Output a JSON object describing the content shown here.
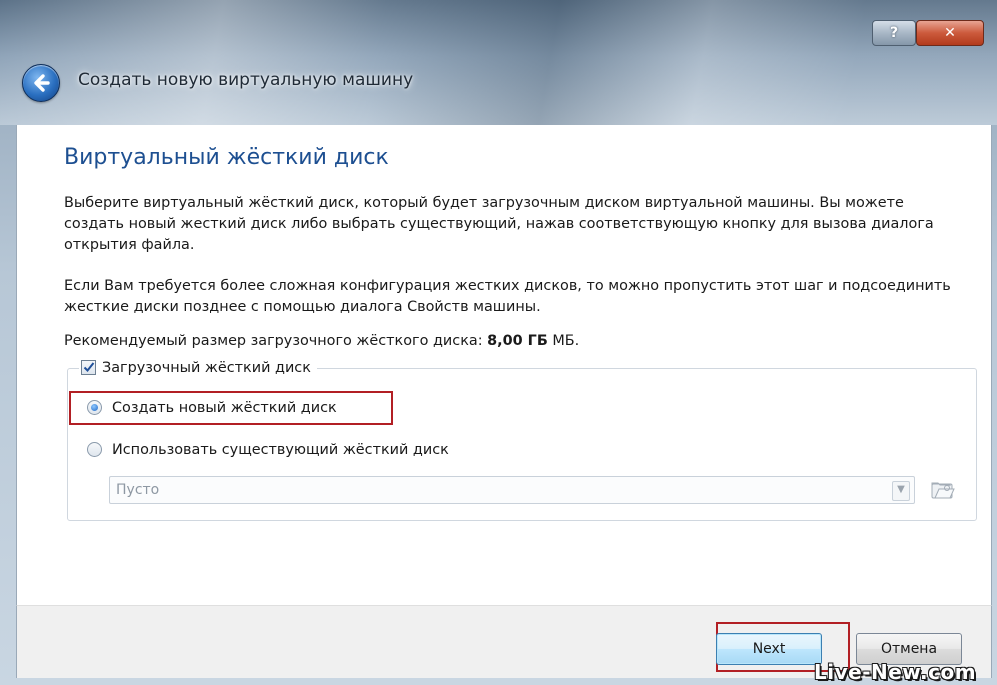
{
  "window": {
    "title": "Создать новую виртуальную машину",
    "help_label": "?",
    "close_label": "✕"
  },
  "page": {
    "heading": "Виртуальный жёсткий диск",
    "paragraph1": "Выберите виртуальный жёсткий диск, который будет загрузочным диском виртуальной машины. Вы можете создать новый жесткий диск либо выбрать существующий, нажав соответствующую кнопку для вызова диалога открытия файла.",
    "paragraph2": "Если Вам требуется более сложная конфигурация жестких дисков, то можно пропустить этот шаг и подсоединить жесткие диски позднее с помощью диалога Свойств машины.",
    "recommended_prefix": "Рекомендуемый размер загрузочного жёсткого диска:",
    "recommended_value": "8,00 ГБ",
    "recommended_suffix": "МБ."
  },
  "boot_group": {
    "checkbox_label": "Загрузочный жёсткий диск",
    "checked": true,
    "option_create": "Создать новый жёсткий диск",
    "option_existing": "Использовать существующий жёсткий диск",
    "selected": "create",
    "select_value": "Пусто"
  },
  "buttons": {
    "next": "Next",
    "cancel": "Отмена"
  },
  "watermark": "Live-New.com",
  "colors": {
    "heading": "#1d4f91",
    "highlight": "#b21f24"
  },
  "icons": [
    "back-arrow-icon",
    "help-icon",
    "close-icon",
    "checkmark-icon",
    "folder-open-icon",
    "chevron-down-icon"
  ]
}
